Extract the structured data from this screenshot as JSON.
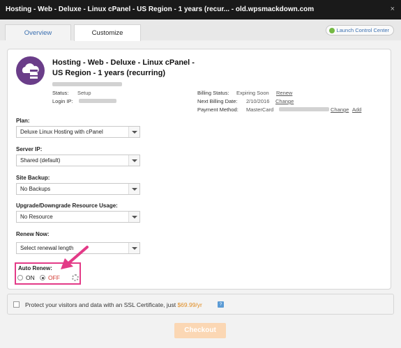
{
  "window": {
    "title": "Hosting - Web - Deluxe - Linux cPanel - US Region - 1 years (recur... - old.wpsmackdown.com",
    "close_glyph": "×"
  },
  "tabs": [
    {
      "label": "Overview",
      "active": false
    },
    {
      "label": "Customize",
      "active": true
    }
  ],
  "launch_button": {
    "label": "Launch Control Center"
  },
  "product": {
    "title_line1": "Hosting - Web - Deluxe - Linux cPanel -",
    "title_line2": "US Region - 1 years (recurring)",
    "status_label": "Status:",
    "status_value": "Setup",
    "login_ip_label": "Login IP:"
  },
  "billing": {
    "status_label": "Billing Status:",
    "status_value": "Expiring Soon",
    "renew_link": "Renew",
    "next_date_label": "Next Billing Date:",
    "next_date_value": "2/10/2016",
    "change_link": "Change",
    "payment_label": "Payment Method:",
    "payment_value": "MasterCard",
    "payment_change_link": "Change",
    "payment_add_link": "Add"
  },
  "fields": {
    "plan": {
      "label": "Plan:",
      "value": "Deluxe Linux Hosting with cPanel"
    },
    "server_ip": {
      "label": "Server IP:",
      "value": "Shared (default)"
    },
    "site_backup": {
      "label": "Site Backup:",
      "value": "No Backups"
    },
    "upgrade": {
      "label": "Upgrade/Downgrade Resource Usage:",
      "value": "No Resource"
    },
    "renew_now": {
      "label": "Renew Now:",
      "value": "Select renewal length"
    }
  },
  "auto_renew": {
    "label": "Auto Renew:",
    "on_label": "ON",
    "off_label": "OFF",
    "selected": "OFF",
    "off_color": "#d0342c"
  },
  "ssl": {
    "text": "Protect your visitors and data with an SSL Certificate, just",
    "price": "$69.99/yr",
    "help_glyph": "?"
  },
  "checkout": {
    "label": "Checkout"
  },
  "colors": {
    "accent_link": "#3a6fb0",
    "highlight_pink": "#e33a87",
    "logo_purple": "#6a3d89",
    "price_orange": "#e08a1e"
  }
}
